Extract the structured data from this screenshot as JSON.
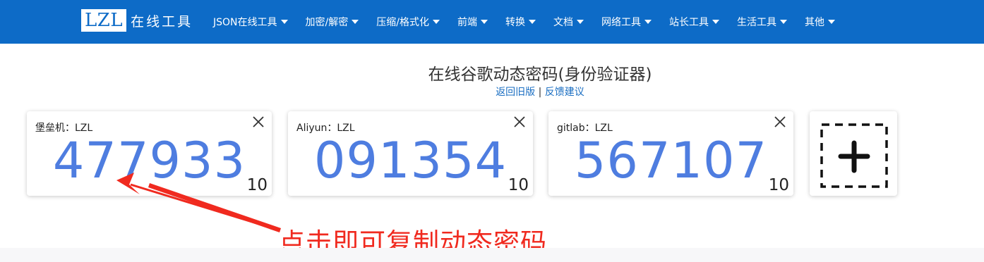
{
  "navbar": {
    "logo_box": "LZL",
    "logo_text": "在线工具",
    "items": [
      {
        "label": "JSON在线工具"
      },
      {
        "label": "加密/解密"
      },
      {
        "label": "压缩/格式化"
      },
      {
        "label": "前端"
      },
      {
        "label": "转换"
      },
      {
        "label": "文档"
      },
      {
        "label": "网络工具"
      },
      {
        "label": "站长工具"
      },
      {
        "label": "生活工具"
      },
      {
        "label": "其他"
      }
    ]
  },
  "page": {
    "title": "在线谷歌动态密码(身份验证器)",
    "link_old": "返回旧版",
    "separator": "|",
    "link_feedback": "反馈建议"
  },
  "cards": [
    {
      "name": "堡垒机：LZL",
      "code": "477933",
      "timer": "10"
    },
    {
      "name": "Aliyun：LZL",
      "code": "091354",
      "timer": "10"
    },
    {
      "name": "gitlab：LZL",
      "code": "567107",
      "timer": "10"
    }
  ],
  "annotation": {
    "text": "点击即可复制动态密码",
    "color": "#f02a1f"
  },
  "colors": {
    "navbar": "#0d6bc7",
    "code": "#4e7de0",
    "link": "#1a6ec2"
  },
  "icons": {
    "close": "close-icon",
    "add": "plus-icon",
    "dropdown": "caret-down-icon"
  }
}
